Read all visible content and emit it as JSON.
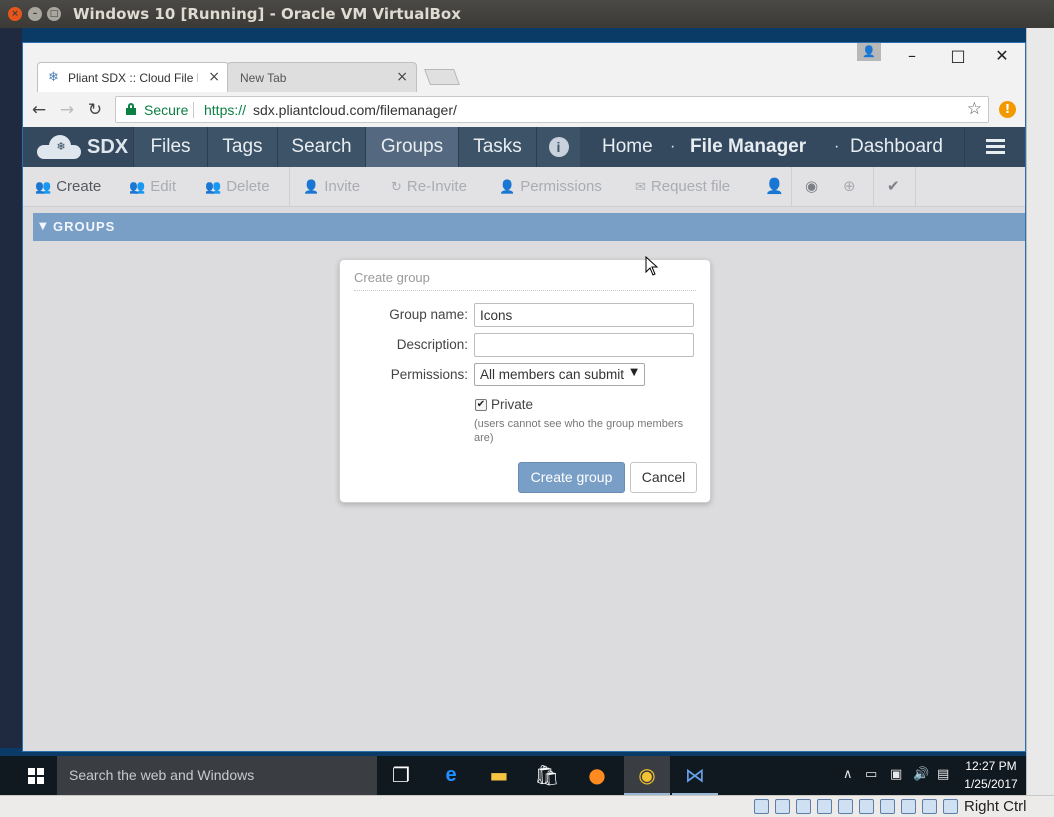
{
  "host": {
    "title": "Windows 10 [Running] - Oracle VM VirtualBox",
    "host_key_label": "Right Ctrl"
  },
  "browser": {
    "tabs": [
      {
        "title": "Pliant SDX :: Cloud File M",
        "active": true
      },
      {
        "title": "New Tab",
        "active": false
      }
    ],
    "security_label": "Secure",
    "url_scheme": "https://",
    "url_rest": "sdx.pliantcloud.com/filemanager/"
  },
  "app": {
    "logo_text": "SDX",
    "nav": {
      "files": "Files",
      "tags": "Tags",
      "search": "Search",
      "groups": "Groups",
      "tasks": "Tasks",
      "home": "Home",
      "separator": "·",
      "file_manager": "File Manager",
      "dashboard": "Dashboard"
    },
    "actions": {
      "create": "Create",
      "edit": "Edit",
      "delete": "Delete",
      "invite": "Invite",
      "reinvite": "Re-Invite",
      "permissions": "Permissions",
      "request_file": "Request file"
    },
    "section_title": "GROUPS"
  },
  "dialog": {
    "title": "Create group",
    "group_name_label": "Group name:",
    "group_name_value": "Icons",
    "description_label": "Description:",
    "description_value": "",
    "permissions_label": "Permissions:",
    "permissions_value": "All members can submit",
    "private_label": "Private",
    "private_checked": true,
    "private_hint": "(users cannot see who the group members are)",
    "create_button": "Create group",
    "cancel_button": "Cancel"
  },
  "taskbar": {
    "search_placeholder": "Search the web and Windows",
    "time": "12:27 PM",
    "date": "1/25/2017"
  },
  "colors": {
    "nav_bg": "#34495e",
    "nav_active": "#54697f",
    "section_header": "#7a9fc7",
    "primary_button": "#7a9fc7",
    "secure_green": "#0b8043"
  }
}
